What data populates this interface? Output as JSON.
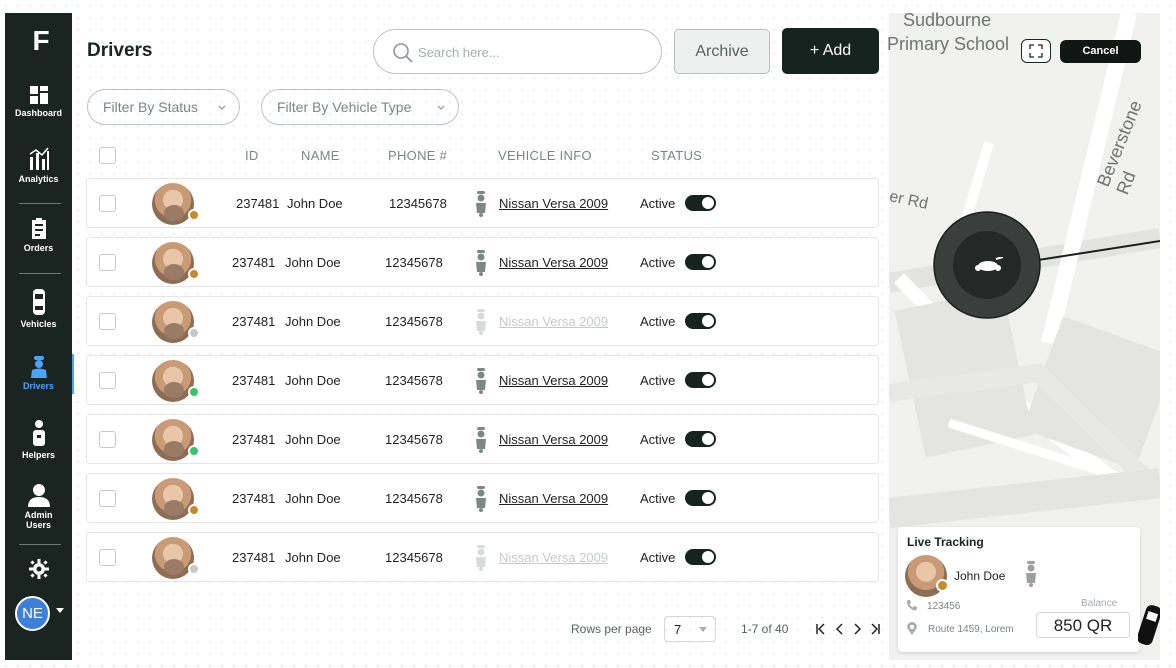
{
  "sidebar": {
    "logo": "F",
    "items": [
      {
        "label": "Dashboard"
      },
      {
        "label": "Analytics"
      },
      {
        "label": "Orders"
      },
      {
        "label": "Vehicles"
      },
      {
        "label": "Drivers"
      },
      {
        "label": "Helpers"
      },
      {
        "label": "Admin Users"
      }
    ],
    "user_initials": "NE"
  },
  "header": {
    "title": "Drivers",
    "search_placeholder": "Search here...",
    "archive_label": "Archive",
    "add_label": "+ Add"
  },
  "filters": {
    "status": "Filter By Status",
    "vehicle_type": "Filter By Vehicle Type"
  },
  "table": {
    "columns": [
      "ID",
      "NAME",
      "PHONE #",
      "VEHICLE INFO",
      "STATUS"
    ],
    "rows": [
      {
        "id": "237481",
        "name": "John Doe",
        "phone": "12345678",
        "vehicle": "Nissan Versa 2009",
        "status": "Active",
        "presence_color": "#c78a2c",
        "vehicle_dim": false
      },
      {
        "id": "237481",
        "name": "John Doe",
        "phone": "12345678",
        "vehicle": "Nissan Versa 2009",
        "status": "Active",
        "presence_color": "#c78a2c",
        "vehicle_dim": false
      },
      {
        "id": "237481",
        "name": "John Doe",
        "phone": "12345678",
        "vehicle": "Nissan Versa 2009",
        "status": "Active",
        "presence_color": "#c8c8c8",
        "vehicle_dim": true
      },
      {
        "id": "237481",
        "name": "John Doe",
        "phone": "12345678",
        "vehicle": "Nissan Versa 2009",
        "status": "Active",
        "presence_color": "#35c46b",
        "vehicle_dim": false
      },
      {
        "id": "237481",
        "name": "John Doe",
        "phone": "12345678",
        "vehicle": "Nissan Versa 2009",
        "status": "Active",
        "presence_color": "#35c46b",
        "vehicle_dim": false
      },
      {
        "id": "237481",
        "name": "John Doe",
        "phone": "12345678",
        "vehicle": "Nissan Versa 2009",
        "status": "Active",
        "presence_color": "#c78a2c",
        "vehicle_dim": false
      },
      {
        "id": "237481",
        "name": "John Doe",
        "phone": "12345678",
        "vehicle": "Nissan Versa 2009",
        "status": "Active",
        "presence_color": "#c8c8c8",
        "vehicle_dim": true
      }
    ]
  },
  "pagination": {
    "rows_per_page_label": "Rows per page",
    "rows_per_page": "7",
    "range": "1-7 of 40"
  },
  "map": {
    "labels": [
      "Sudbourne",
      "Primary School",
      "Beverstone Rd",
      "er Rd"
    ],
    "cancel_label": "Cancel",
    "live_tracking": {
      "title": "Live Tracking",
      "driver_name": "John Doe",
      "phone": "123456",
      "address": "Route 1459, Lorem",
      "balance_label": "Balance",
      "balance": "850 QR"
    }
  },
  "colors": {
    "sidebar_bg": "#1a2421",
    "accent": "#4aa3ff",
    "primary_button": "#17231f"
  }
}
